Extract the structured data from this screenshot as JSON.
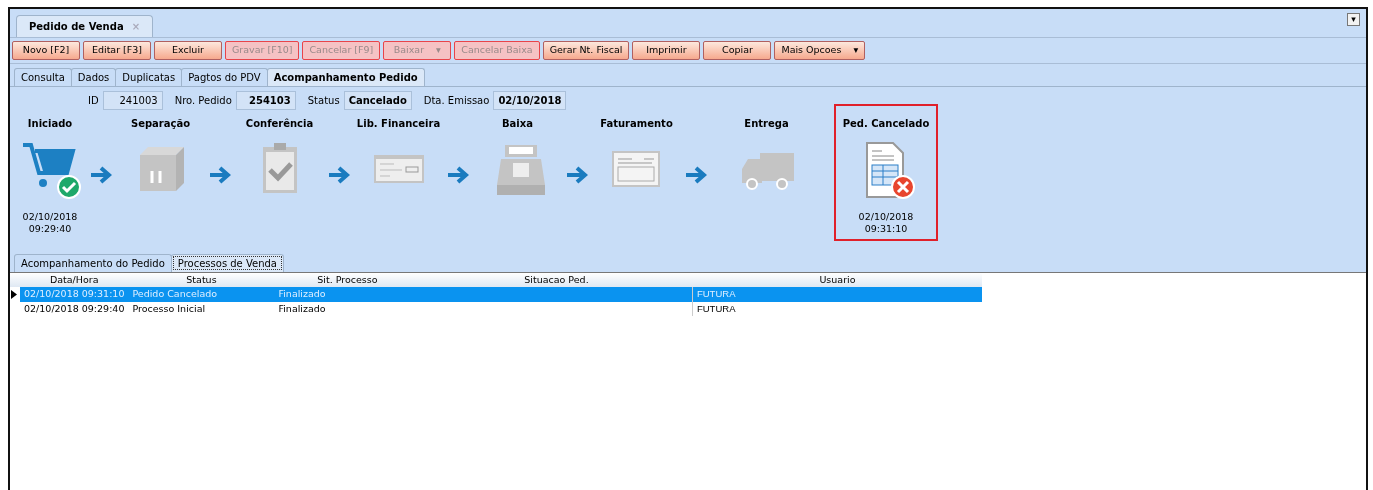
{
  "window": {
    "title": "Pedido de Venda",
    "close": "×",
    "menu": "▾"
  },
  "toolbar": [
    {
      "label": "Novo [F2]",
      "enabled": true
    },
    {
      "label": "Editar [F3]",
      "enabled": true
    },
    {
      "label": "Excluir",
      "enabled": true
    },
    {
      "label": "Gravar [F10]",
      "enabled": false
    },
    {
      "label": "Cancelar [F9]",
      "enabled": false
    },
    {
      "label": "Baixar",
      "enabled": false,
      "caret": "▾"
    },
    {
      "label": "Cancelar Baixa",
      "enabled": false
    },
    {
      "label": "Gerar Nt. Fiscal",
      "enabled": true
    },
    {
      "label": "Imprimir",
      "enabled": true
    },
    {
      "label": "Copiar",
      "enabled": true
    },
    {
      "label": "Mais Opcoes",
      "enabled": true,
      "caret": "▾"
    }
  ],
  "tabs": [
    {
      "label": "Consulta",
      "selected": false
    },
    {
      "label": "Dados",
      "selected": false
    },
    {
      "label": "Duplicatas",
      "selected": false
    },
    {
      "label": "Pagtos do PDV",
      "selected": false
    },
    {
      "label": "Acompanhamento Pedido",
      "selected": true
    }
  ],
  "fields": [
    {
      "label": "ID",
      "value": "241003",
      "bold": false
    },
    {
      "label": "Nro. Pedido",
      "value": "254103",
      "bold": true
    },
    {
      "label": "Status",
      "value": "Cancelado",
      "bold": true
    },
    {
      "label": "Dta. Emissao",
      "value": "02/10/2018",
      "bold": true
    }
  ],
  "stages": [
    {
      "label": "Iniciado",
      "kind": "cart",
      "completed": true,
      "cancelled": false,
      "date": "02/10/2018",
      "time": "09:29:40"
    },
    {
      "label": "Separação",
      "kind": "box",
      "completed": false,
      "cancelled": false
    },
    {
      "label": "Conferência",
      "kind": "clipboard",
      "completed": false,
      "cancelled": false
    },
    {
      "label": "Lib. Financeira",
      "kind": "cheque",
      "completed": false,
      "cancelled": false
    },
    {
      "label": "Baixa",
      "kind": "register",
      "completed": false,
      "cancelled": false
    },
    {
      "label": "Faturamento",
      "kind": "invoice",
      "completed": false,
      "cancelled": false
    },
    {
      "label": "Entrega",
      "kind": "truck",
      "completed": false,
      "cancelled": false
    },
    {
      "label": "Ped. Cancelado",
      "kind": "order",
      "completed": false,
      "cancelled": true,
      "date": "02/10/2018",
      "time": "09:31:10"
    }
  ],
  "subtabs": [
    {
      "label": "Acompanhamento do Pedido",
      "selected": false
    },
    {
      "label": "Processos de Venda",
      "selected": true
    }
  ],
  "table": {
    "columns": [
      "Data/Hora",
      "Status",
      "Sit. Processo",
      "Situacao Ped.",
      "Usuario"
    ],
    "rows": [
      {
        "selected": true,
        "cells": [
          "02/10/2018 09:31:10",
          "Pedido Cancelado",
          "Finalizado",
          "",
          "FUTURA"
        ]
      },
      {
        "selected": false,
        "cells": [
          "02/10/2018 09:29:40",
          "Processo Inicial",
          "Finalizado",
          "",
          "FUTURA"
        ]
      }
    ]
  }
}
